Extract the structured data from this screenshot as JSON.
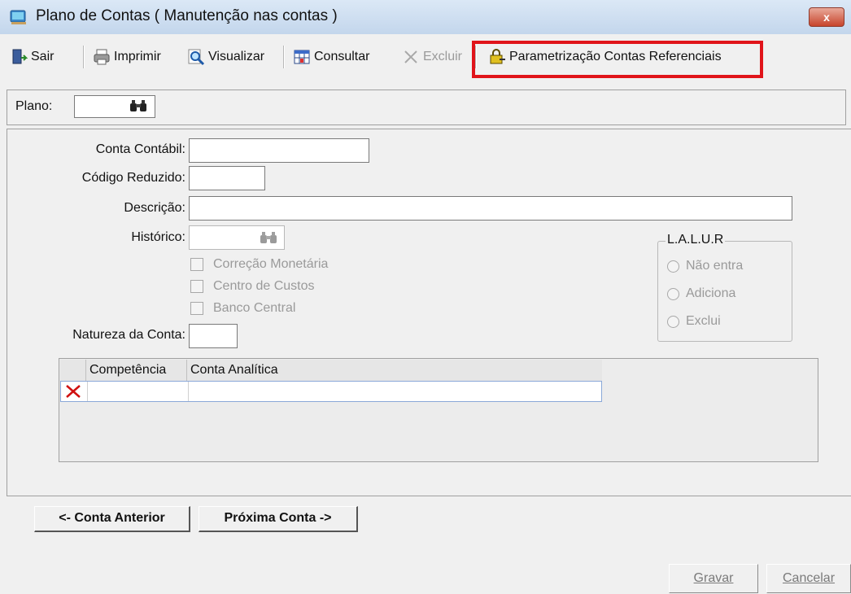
{
  "window": {
    "title": "Plano de Contas ( Manutenção nas contas )",
    "close_label": "x"
  },
  "toolbar": {
    "sair": "Sair",
    "imprimir": "Imprimir",
    "visualizar": "Visualizar",
    "consultar": "Consultar",
    "excluir": "Excluir",
    "parametrizacao": "Parametrização Contas Referenciais"
  },
  "plano": {
    "label": "Plano:",
    "value": ""
  },
  "form": {
    "conta_contabil_label": "Conta Contábil:",
    "codigo_reduzido_label": "Código Reduzido:",
    "descricao_label": "Descrição:",
    "historico_label": "Histórico:",
    "natureza_label": "Natureza da Conta:",
    "checkboxes": [
      "Correção Monetária",
      "Centro de Custos",
      "Banco Central"
    ]
  },
  "lalur": {
    "title": "L.A.L.U.R",
    "options": [
      "Não entra",
      "Adiciona",
      "Exclui"
    ]
  },
  "grid": {
    "columns": [
      "Competência",
      "Conta Analítica"
    ],
    "rows": [
      {
        "competencia": "",
        "conta_analitica": ""
      }
    ]
  },
  "nav": {
    "prev": "<- Conta Anterior",
    "next": "Próxima Conta ->"
  },
  "actions": {
    "gravar": "Gravar",
    "cancelar": "Cancelar"
  },
  "colors": {
    "highlight": "#e0141a",
    "delete_mark": "#d01010"
  }
}
